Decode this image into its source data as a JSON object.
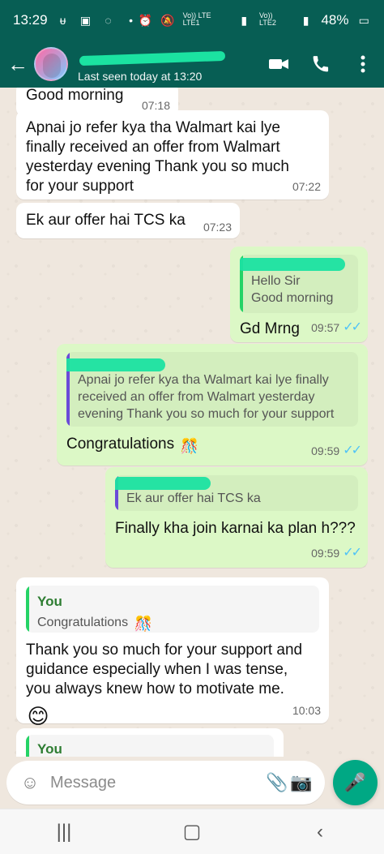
{
  "status_bar": {
    "time": "13:29",
    "left_icons": [
      "notification-icon",
      "image-icon",
      "whatsapp-icon",
      "dot-icon"
    ],
    "right_text": "48%",
    "network_text_1": "Vo)) LTE\nLTE1",
    "network_text_2": "Vo))\nLTE2"
  },
  "header": {
    "subtitle": "Last seen today at 13:20",
    "actions": [
      "video-call-icon",
      "phone-icon",
      "more-icon"
    ],
    "colors": {
      "bg": "#075e54",
      "redaction": "#1be2a1"
    }
  },
  "messages": [
    {
      "dir": "in",
      "text": "Good morning",
      "time": "07:18"
    },
    {
      "dir": "in",
      "text": "Apnai jo refer kya tha Walmart kai lye\nfinally received an offer from Walmart\nyesterday evening Thank you so much\nfor your support",
      "time": "07:22"
    },
    {
      "dir": "in",
      "text": "Ek aur offer hai TCS ka",
      "time": "07:23"
    },
    {
      "dir": "out",
      "quote_text": "Hello Sir\nGood morning",
      "text": "Gd Mrng",
      "time": "09:57"
    },
    {
      "dir": "out",
      "quote_text": "Apnai jo refer kya tha Walmart kai lye finally\nreceived an offer from Walmart yesterday\nevening Thank you so much for your support",
      "text": "Congratulations",
      "time": "09:59"
    },
    {
      "dir": "out",
      "quote_text": "Ek aur offer hai TCS ka",
      "text": "Finally kha join karnai ka plan h???",
      "time": "09:59"
    },
    {
      "dir": "in",
      "quote_title": "You",
      "quote_text": "Congratulations",
      "text": "Thank you so much for your support and\nguidance especially when I was tense,\nyou always knew how to motivate me.",
      "time": "10:03"
    },
    {
      "dir": "in",
      "quote_title": "You",
      "text": "",
      "time": ""
    }
  ],
  "composer": {
    "placeholder": "Message",
    "icons": [
      "emoji-icon",
      "attach-icon",
      "camera-icon",
      "mic-icon"
    ]
  },
  "nav": {
    "icons": [
      "recent-apps-icon",
      "home-icon",
      "back-icon"
    ]
  }
}
